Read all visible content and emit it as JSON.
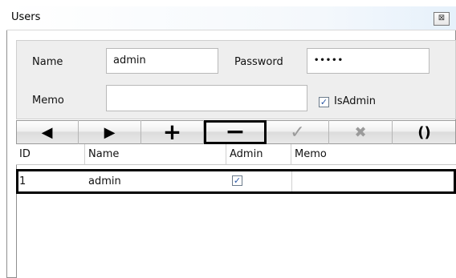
{
  "window": {
    "title": "Users",
    "close_glyph": "⊠"
  },
  "form": {
    "name_label": "Name",
    "name_value": "admin",
    "password_label": "Password",
    "password_value": "•••••",
    "memo_label": "Memo",
    "memo_value": "",
    "isadmin_label": "IsAdmin",
    "isadmin_checked": true,
    "check_glyph": "✓"
  },
  "toolbar": {
    "prev_glyph": "◀",
    "next_glyph": "▶",
    "add_glyph": "+",
    "delete_glyph": "−",
    "save_glyph": "✓",
    "cancel_glyph": "✖",
    "refresh_glyph": "()"
  },
  "grid": {
    "columns": [
      "ID",
      "Name",
      "Admin",
      "Memo"
    ],
    "rows": [
      {
        "id": "1",
        "name": "admin",
        "admin": true,
        "memo": ""
      }
    ]
  }
}
